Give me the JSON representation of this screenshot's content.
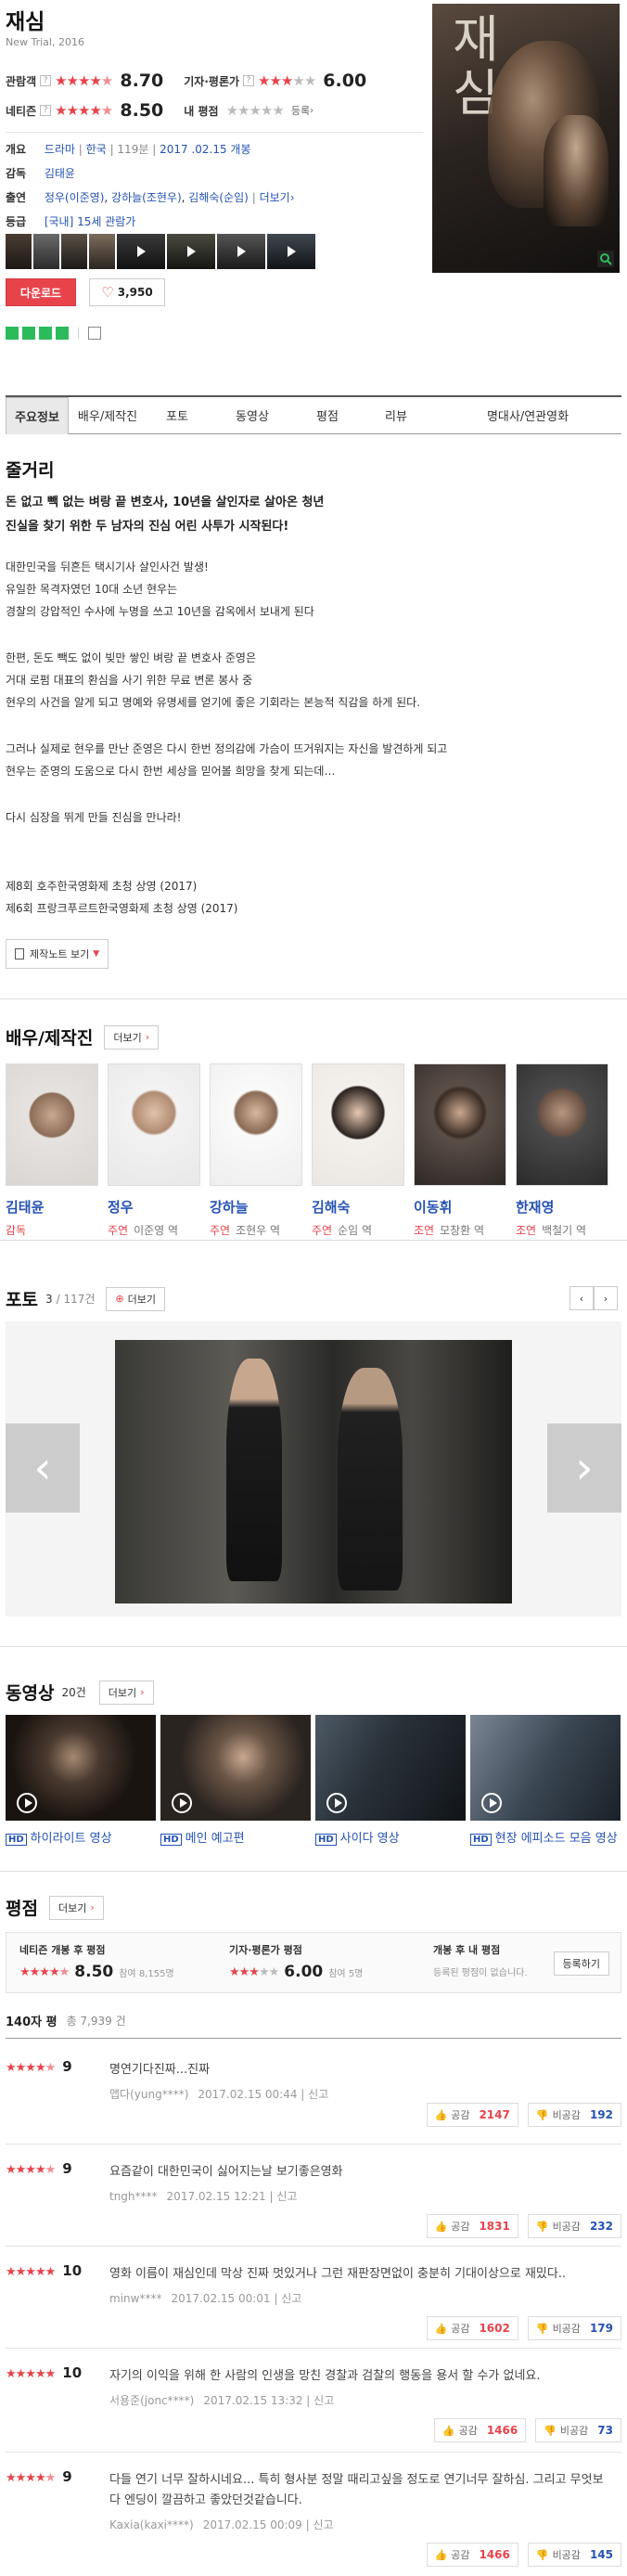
{
  "movie": {
    "title": "재심",
    "subtitle": "New Trial, 2016",
    "audience_label": "관람객",
    "audience_score": "8.70",
    "critic_label": "기자·평론가",
    "critic_score": "6.00",
    "netizen_label": "네티즌",
    "netizen_score": "8.50",
    "my_label": "내 평점",
    "register_link": "등록",
    "q_mark": "?"
  },
  "info": {
    "rows": [
      {
        "label": "개요",
        "values": [
          "드라마",
          "한국",
          "119분",
          "2017 .02.15 개봉"
        ]
      },
      {
        "label": "감독",
        "values": [
          "김태윤"
        ]
      },
      {
        "label": "출연",
        "values": [
          "정우(이준영)",
          "강하늘(조현우)",
          "김해숙(순임)"
        ],
        "more": "더보기"
      },
      {
        "label": "등급",
        "values": [
          "[국내] 15세 관람가"
        ]
      }
    ],
    "download_label": "다운로드",
    "like_count": "3,950"
  },
  "tabs": [
    "주요정보",
    "배우/제작진",
    "포토",
    "동영상",
    "평점",
    "리뷰",
    "명대사/연관영화"
  ],
  "story": {
    "heading": "줄거리",
    "lead": [
      "돈 없고 빽 없는 벼랑 끝 변호사, 10년을 살인자로 살아온 청년",
      "진실을 찾기 위한 두 남자의 진심 어린 사투가 시작된다!"
    ],
    "paras": [
      [
        "대한민국을 뒤흔든 택시기사 살인사건 발생!",
        "유일한 목격자였던 10대 소년 현우는",
        "경찰의 강압적인 수사에 누명을 쓰고 10년을 감옥에서 보내게 된다"
      ],
      [
        "한편, 돈도 빽도 없이 빚만 쌓인 벼랑 끝 변호사 준영은",
        "거대 로펌 대표의 환심을 사기 위한 무료 변론 봉사 중",
        "현우의 사건을 알게 되고 명예와 유명세를 얻기에 좋은 기회라는 본능적 직감을 하게 된다."
      ],
      [
        "그러나 실제로 현우를 만난 준영은 다시 한번 정의감에 가슴이 뜨거워지는 자신을 발견하게 되고",
        "현우는 준영의 도움으로 다시 한번 세상을 믿어볼 희망을 찾게 되는데…"
      ],
      [
        "다시 심장을 뛰게 만들 진심을 만나라!"
      ],
      [
        "제8회 호주한국영화제 초청 상영 (2017)",
        "제6회 프랑크푸르트한국영화제 초청 상영 (2017)"
      ]
    ],
    "note_button": "제작노트 보기"
  },
  "cast": {
    "heading": "배우/제작진",
    "more": "더보기",
    "members": [
      {
        "name": "김태윤",
        "type": "감독",
        "role": ""
      },
      {
        "name": "정우",
        "type": "주연",
        "role": "이준영 역"
      },
      {
        "name": "강하늘",
        "type": "주연",
        "role": "조현우 역"
      },
      {
        "name": "김해숙",
        "type": "주연",
        "role": "순임 역"
      },
      {
        "name": "이동휘",
        "type": "조연",
        "role": "모창환 역"
      },
      {
        "name": "한재영",
        "type": "조연",
        "role": "백철기 역"
      }
    ]
  },
  "photo": {
    "heading": "포토",
    "count": "3",
    "total": "/ 117건",
    "more": "더보기"
  },
  "video": {
    "heading": "동영상",
    "count": "20건",
    "more": "더보기",
    "items": [
      "하이라이트 영상",
      "메인 예고편",
      "사이다 영상",
      "현장 에피소드 모음 영상"
    ],
    "hd": "HD"
  },
  "rating": {
    "heading": "평점",
    "more": "더보기",
    "netizen_label": "네티즌 개봉 후 평점",
    "netizen_score": "8.50",
    "netizen_count": "참여 8,155명",
    "critic_label": "기자·평론가 평점",
    "critic_score": "6.00",
    "critic_count": "참여 5명",
    "after_label": "개봉 후 내 평점",
    "after_text": "등록된 평점이 없습니다.",
    "register_button": "등록하기",
    "total_label": "140자 평",
    "total_count": "총 7,939 건",
    "agree": "공감",
    "disagree": "비공감",
    "reviews": [
      {
        "score": "9",
        "text": "명연기다진짜...진짜",
        "user": "앱다(yung****)",
        "date": "2017.02.15 00:44",
        "report": "신고",
        "agree": "2147",
        "disagree": "192"
      },
      {
        "score": "9",
        "text": "요즘같이 대한민국이 싫어지는날 보기좋은영화",
        "user": "tngh****",
        "date": "2017.02.15 12:21",
        "report": "신고",
        "agree": "1831",
        "disagree": "232"
      },
      {
        "score": "10",
        "text": "영화 이름이 재심인데 막상 진짜 멋있거나 그런 재판장면없이 충분히 기대이상으로 재밌다..",
        "user": "minw****",
        "date": "2017.02.15 00:01",
        "report": "신고",
        "agree": "1602",
        "disagree": "179"
      },
      {
        "score": "10",
        "text": "자기의 이익을 위해 한 사람의 인생을 망친 경찰과 검찰의 행동을 용서 할 수가 없네요.",
        "user": "서용준(jonc****)",
        "date": "2017.02.15 13:32",
        "report": "신고",
        "agree": "1466",
        "disagree": "73"
      },
      {
        "score": "9",
        "text": "다들 연기 너무 잘하시네요... 특히 형사분 정말 때리고싶을 정도로 연기너무 잘하심. 그리고 무엇보다 엔딩이 깔끔하고 좋았던것같습니다.",
        "user": "Kaxia(kaxi****)",
        "date": "2017.02.15 00:09",
        "report": "신고",
        "agree": "1466",
        "disagree": "145"
      }
    ]
  },
  "colors": {
    "accent": "#e8434b",
    "link": "#2552b4",
    "dark": "#222222"
  }
}
